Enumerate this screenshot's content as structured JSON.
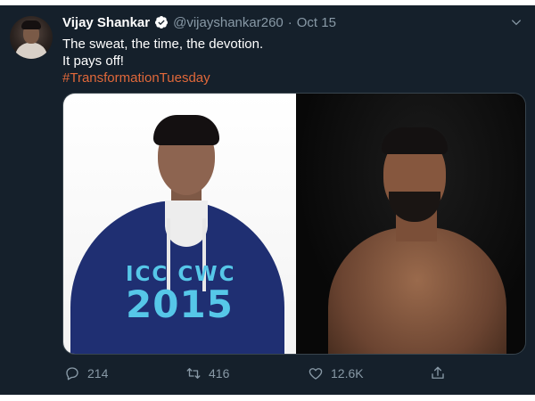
{
  "tweet": {
    "author_name": "Vijay Shankar",
    "handle": "@vijayshankar260",
    "separator": "·",
    "date": "Oct 15",
    "lines": [
      "The sweat, the time, the devotion.",
      "It pays off!"
    ],
    "hashtag": "#TransformationTuesday"
  },
  "media": {
    "left_logo_line1": "ICC CWC",
    "left_logo_line2": "2015"
  },
  "actions": {
    "reply_count": "214",
    "retweet_count": "416",
    "like_count": "12.6K"
  },
  "icons": {
    "verified": "verified-badge-icon",
    "menu": "chevron-down-icon",
    "reply": "comment-icon",
    "retweet": "retweet-icon",
    "like": "heart-icon",
    "share": "share-icon"
  },
  "colors": {
    "background": "#15202b",
    "secondary_text": "#8899a6",
    "hashtag": "#e0683a",
    "verified": "#ffffff"
  }
}
